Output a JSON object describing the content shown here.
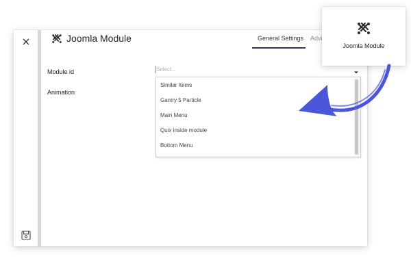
{
  "modal": {
    "title": "Joomla Module",
    "tabs": [
      {
        "label": "General Settings",
        "active": true
      },
      {
        "label": "Adva",
        "active": false
      }
    ],
    "rail": {
      "close_icon": "close-icon",
      "save_icon": "save-icon"
    }
  },
  "form": {
    "module_id_label": "Module id",
    "module_id_placeholder": "Select...",
    "animation_label": "Animation"
  },
  "dropdown": {
    "options": [
      "Similar Items",
      "Gantry 5 Particle",
      "Main Menu",
      "Quix inside module",
      "Bottom Menu"
    ]
  },
  "callout": {
    "label": "Joomla Module",
    "icon": "joomla-logo-icon"
  },
  "colors": {
    "accent_underline": "#2c3e58",
    "arrow": "#4b56d8"
  }
}
